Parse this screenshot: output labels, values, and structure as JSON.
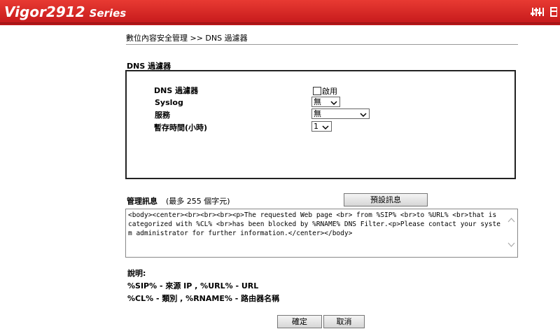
{
  "header": {
    "model": "Vigor2912",
    "series": "Series",
    "icons": [
      "equalizer-icon",
      "grid-icon"
    ]
  },
  "breadcrumb": "數位內容安全管理 >> DNS 過濾器",
  "section_title": "DNS 過濾器",
  "form": {
    "dns_filter_label": "DNS 過濾器",
    "enable_label": "啟用",
    "enable_checked": false,
    "syslog_label": "Syslog",
    "syslog_value": "無",
    "service_label": "服務",
    "service_value": "無",
    "cache_label": "暫存時間(小時)",
    "cache_value": "1"
  },
  "management": {
    "label": "管理訊息",
    "limit": "(最多 255 個字元)",
    "default_button": "預設訊息",
    "message": "<body><center><br><br><br><p>The requested Web page <br> from %SIP% <br>to %URL% <br>that is categorized with %CL% <br>has been blocked by %RNAME% DNS Filter.<p>Please contact your system administrator for further information.</center></body>"
  },
  "notes": {
    "title": "說明:",
    "line1": "%SIP% - 來源 IP , %URL% - URL",
    "line2": "%CL% - 類別 , %RNAME% - 路由器名稱"
  },
  "buttons": {
    "ok": "確定",
    "cancel": "取消"
  },
  "colors": {
    "header_red": "#d9251f",
    "header_text": "#ffffff"
  }
}
